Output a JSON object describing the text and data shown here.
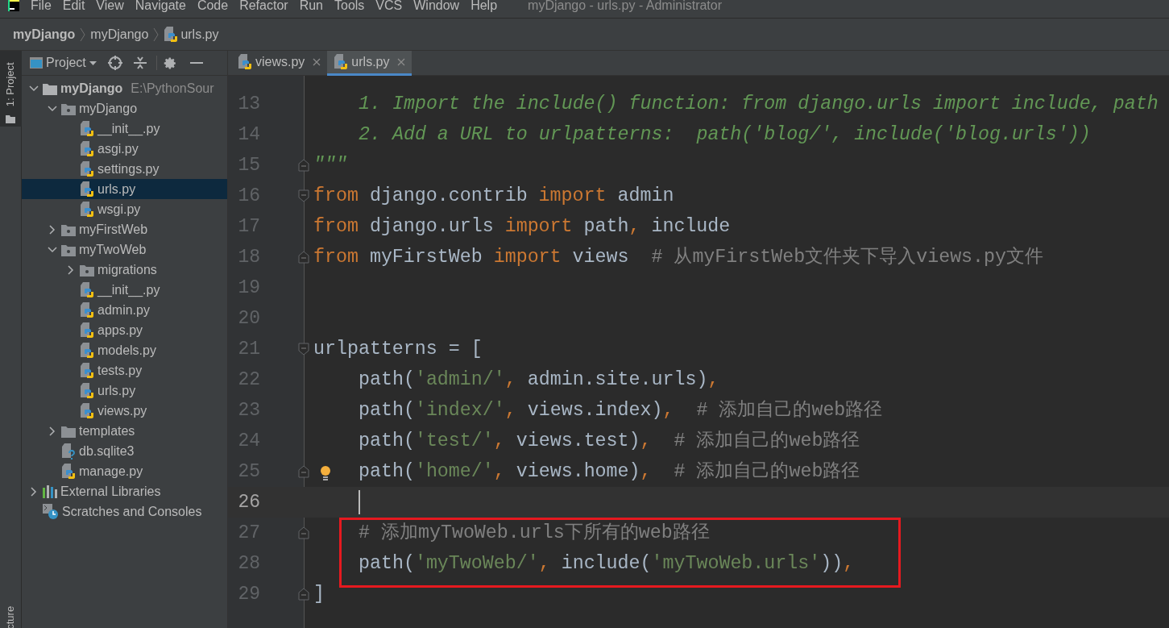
{
  "menu_bar": {
    "items": [
      "File",
      "Edit",
      "View",
      "Navigate",
      "Code",
      "Refactor",
      "Run",
      "Tools",
      "VCS",
      "Window",
      "Help"
    ],
    "title": "myDjango - urls.py - Administrator"
  },
  "breadcrumbs": [
    {
      "label": "myDjango",
      "kind": "project"
    },
    {
      "label": "myDjango",
      "kind": "folder"
    },
    {
      "label": "urls.py",
      "kind": "python"
    }
  ],
  "side_strip": {
    "top_tab": "1: Project",
    "bottom_tab": "cture"
  },
  "project_panel": {
    "title": "Project",
    "tree": [
      {
        "label": "myDjango",
        "path": "E:\\PythonSour",
        "kind": "project",
        "expanded": true,
        "selected": false,
        "children": [
          {
            "label": "myDjango",
            "kind": "package",
            "expanded": true,
            "selected": false,
            "children": [
              {
                "label": "__init__.py",
                "kind": "python",
                "selected": false
              },
              {
                "label": "asgi.py",
                "kind": "python",
                "selected": false
              },
              {
                "label": "settings.py",
                "kind": "python",
                "selected": false
              },
              {
                "label": "urls.py",
                "kind": "python",
                "selected": true
              },
              {
                "label": "wsgi.py",
                "kind": "python",
                "selected": false
              }
            ]
          },
          {
            "label": "myFirstWeb",
            "kind": "package",
            "expanded": false,
            "selected": false
          },
          {
            "label": "myTwoWeb",
            "kind": "package",
            "expanded": true,
            "selected": false,
            "children": [
              {
                "label": "migrations",
                "kind": "package",
                "expanded": false,
                "selected": false
              },
              {
                "label": "__init__.py",
                "kind": "python",
                "selected": false
              },
              {
                "label": "admin.py",
                "kind": "python",
                "selected": false
              },
              {
                "label": "apps.py",
                "kind": "python",
                "selected": false
              },
              {
                "label": "models.py",
                "kind": "python",
                "selected": false
              },
              {
                "label": "tests.py",
                "kind": "python",
                "selected": false
              },
              {
                "label": "urls.py",
                "kind": "python",
                "selected": false
              },
              {
                "label": "views.py",
                "kind": "python",
                "selected": false
              }
            ]
          },
          {
            "label": "templates",
            "kind": "folder",
            "expanded": false,
            "selected": false
          },
          {
            "label": "db.sqlite3",
            "kind": "unknown",
            "selected": false
          },
          {
            "label": "manage.py",
            "kind": "python",
            "selected": false
          }
        ]
      },
      {
        "label": "External Libraries",
        "kind": "libraries",
        "expanded": false,
        "selected": false
      },
      {
        "label": "Scratches and Consoles",
        "kind": "scratches",
        "selected": false
      }
    ]
  },
  "tabs": [
    {
      "label": "views.py",
      "selected": false
    },
    {
      "label": "urls.py",
      "selected": true
    }
  ],
  "editor": {
    "lines": [
      {
        "number": "13",
        "current": false,
        "indented": true,
        "tokens": [
          {
            "kind": "doc",
            "text": "1. Import the include() function: from django.urls import include, path"
          }
        ]
      },
      {
        "number": "14",
        "current": false,
        "indented": true,
        "tokens": [
          {
            "kind": "doc",
            "text": "2. Add a URL to urlpatterns:  path('blog/', include('blog.urls'))"
          }
        ]
      },
      {
        "number": "15",
        "current": false,
        "fold_close": true,
        "tokens": [
          {
            "kind": "doc",
            "text": "\"\"\""
          }
        ]
      },
      {
        "number": "16",
        "current": false,
        "fold_open": true,
        "tokens": [
          {
            "kind": "keyword",
            "text": "from"
          },
          {
            "kind": "plain",
            "text": " django.contrib "
          },
          {
            "kind": "keyword",
            "text": "import"
          },
          {
            "kind": "plain",
            "text": " admin"
          }
        ]
      },
      {
        "number": "17",
        "current": false,
        "tokens": [
          {
            "kind": "keyword",
            "text": "from"
          },
          {
            "kind": "plain",
            "text": " django.urls "
          },
          {
            "kind": "keyword",
            "text": "import"
          },
          {
            "kind": "plain",
            "text": " path"
          },
          {
            "kind": "keyword",
            "text": ","
          },
          {
            "kind": "plain",
            "text": " include"
          }
        ]
      },
      {
        "number": "18",
        "current": false,
        "fold_close": true,
        "tokens": [
          {
            "kind": "keyword",
            "text": "from"
          },
          {
            "kind": "plain",
            "text": " myFirstWeb "
          },
          {
            "kind": "keyword",
            "text": "import"
          },
          {
            "kind": "plain",
            "text": " views  "
          },
          {
            "kind": "comment",
            "text": "# 从myFirstWeb文件夹下导入views.py文件"
          }
        ]
      },
      {
        "number": "19",
        "current": false
      },
      {
        "number": "20",
        "current": false
      },
      {
        "number": "21",
        "current": false,
        "fold_open": true,
        "tokens": [
          {
            "kind": "plain",
            "text": "urlpatterns = ["
          }
        ]
      },
      {
        "number": "22",
        "current": false,
        "indented": true,
        "tokens": [
          {
            "kind": "plain",
            "text": "path("
          },
          {
            "kind": "string",
            "text": "'admin/'"
          },
          {
            "kind": "keyword",
            "text": ","
          },
          {
            "kind": "plain",
            "text": " admin.site.urls)"
          },
          {
            "kind": "keyword",
            "text": ","
          }
        ]
      },
      {
        "number": "23",
        "current": false,
        "indented": true,
        "tokens": [
          {
            "kind": "plain",
            "text": "path("
          },
          {
            "kind": "string",
            "text": "'index/'"
          },
          {
            "kind": "keyword",
            "text": ","
          },
          {
            "kind": "plain",
            "text": " views.index)"
          },
          {
            "kind": "keyword",
            "text": ",  "
          },
          {
            "kind": "comment",
            "text": "# 添加自己的web路径"
          }
        ]
      },
      {
        "number": "24",
        "current": false,
        "indented": true,
        "tokens": [
          {
            "kind": "plain",
            "text": "path("
          },
          {
            "kind": "string",
            "text": "'test/'"
          },
          {
            "kind": "keyword",
            "text": ","
          },
          {
            "kind": "plain",
            "text": " views.test)"
          },
          {
            "kind": "keyword",
            "text": ",  "
          },
          {
            "kind": "comment",
            "text": "# 添加自己的web路径"
          }
        ]
      },
      {
        "number": "25",
        "current": false,
        "indented": true,
        "fold_close": true,
        "intention": true,
        "tokens": [
          {
            "kind": "plain",
            "text": "path("
          },
          {
            "kind": "string",
            "text": "'home/'"
          },
          {
            "kind": "keyword",
            "text": ","
          },
          {
            "kind": "plain",
            "text": " views.home)"
          },
          {
            "kind": "keyword",
            "text": ",  "
          },
          {
            "kind": "comment",
            "text": "# 添加自己的web路径"
          }
        ]
      },
      {
        "number": "26",
        "current": true,
        "indented": true
      },
      {
        "number": "27",
        "current": false,
        "indented": true,
        "fold_close": true,
        "tokens": [
          {
            "kind": "comment",
            "text": "# 添加myTwoWeb.urls下所有的web路径"
          }
        ]
      },
      {
        "number": "28",
        "current": false,
        "indented": true,
        "tokens": [
          {
            "kind": "plain",
            "text": "path("
          },
          {
            "kind": "string",
            "text": "'myTwoWeb/'"
          },
          {
            "kind": "keyword",
            "text": ","
          },
          {
            "kind": "plain",
            "text": " include("
          },
          {
            "kind": "string",
            "text": "'myTwoWeb.urls'"
          },
          {
            "kind": "plain",
            "text": "))"
          },
          {
            "kind": "keyword",
            "text": ","
          }
        ]
      },
      {
        "number": "29",
        "current": false,
        "fold_close": true,
        "tokens": [
          {
            "kind": "plain",
            "text": "]"
          }
        ]
      }
    ]
  }
}
